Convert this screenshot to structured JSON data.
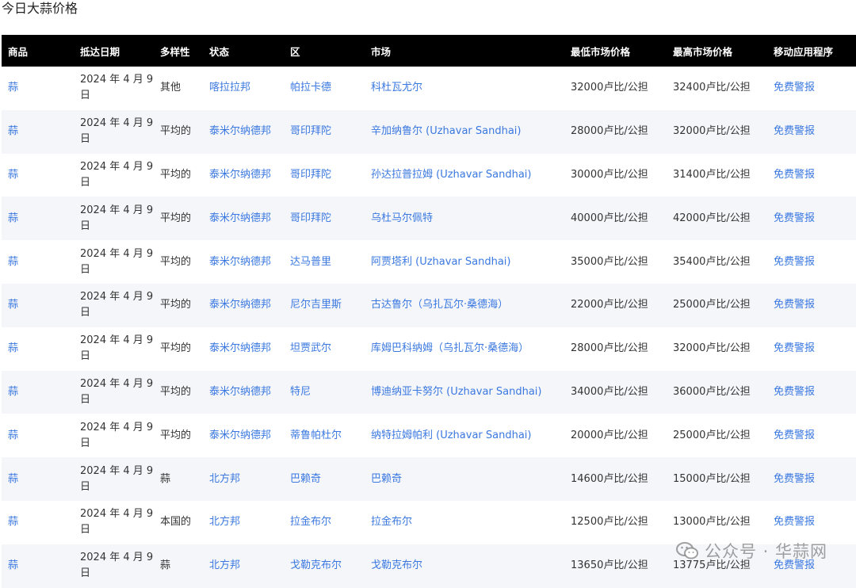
{
  "title": "今日大蒜价格",
  "columns": [
    "商品",
    "抵达日期",
    "多样性",
    "状态",
    "区",
    "市场",
    "最低市场价格",
    "最高市场价格",
    "移动应用程序"
  ],
  "rows": [
    {
      "commodity": "蒜",
      "date": "2024 年 4 月 9 日",
      "variety": "其他",
      "state": "喀拉拉邦",
      "district": "帕拉卡德",
      "market": "科杜瓦尤尔",
      "min": "32000卢比/公担",
      "max": "32400卢比/公担",
      "app": "免费警报"
    },
    {
      "commodity": "蒜",
      "date": "2024 年 4 月 9 日",
      "variety": "平均的",
      "state": "泰米尔纳德邦",
      "district": "哥印拜陀",
      "market": "辛加纳鲁尔 (Uzhavar Sandhai)",
      "min": "28000卢比/公担",
      "max": "32000卢比/公担",
      "app": "免费警报"
    },
    {
      "commodity": "蒜",
      "date": "2024 年 4 月 9 日",
      "variety": "平均的",
      "state": "泰米尔纳德邦",
      "district": "哥印拜陀",
      "market": "孙达拉普拉姆 (Uzhavar Sandhai)",
      "min": "30000卢比/公担",
      "max": "31400卢比/公担",
      "app": "免费警报"
    },
    {
      "commodity": "蒜",
      "date": "2024 年 4 月 9 日",
      "variety": "平均的",
      "state": "泰米尔纳德邦",
      "district": "哥印拜陀",
      "market": "乌杜马尔佩特",
      "min": "40000卢比/公担",
      "max": "42000卢比/公担",
      "app": "免费警报"
    },
    {
      "commodity": "蒜",
      "date": "2024 年 4 月 9 日",
      "variety": "平均的",
      "state": "泰米尔纳德邦",
      "district": "达马普里",
      "market": "阿贾塔利 (Uzhavar Sandhai)",
      "min": "35000卢比/公担",
      "max": "35400卢比/公担",
      "app": "免费警报"
    },
    {
      "commodity": "蒜",
      "date": "2024 年 4 月 9 日",
      "variety": "平均的",
      "state": "泰米尔纳德邦",
      "district": "尼尔吉里斯",
      "market": "古达鲁尔（乌扎瓦尔·桑德海）",
      "min": "22000卢比/公担",
      "max": "25000卢比/公担",
      "app": "免费警报"
    },
    {
      "commodity": "蒜",
      "date": "2024 年 4 月 9 日",
      "variety": "平均的",
      "state": "泰米尔纳德邦",
      "district": "坦贾武尔",
      "market": "库姆巴科纳姆（乌扎瓦尔·桑德海）",
      "min": "28000卢比/公担",
      "max": "32000卢比/公担",
      "app": "免费警报"
    },
    {
      "commodity": "蒜",
      "date": "2024 年 4 月 9 日",
      "variety": "平均的",
      "state": "泰米尔纳德邦",
      "district": "特尼",
      "market": "博迪纳亚卡努尔 (Uzhavar Sandhai)",
      "min": "34000卢比/公担",
      "max": "36000卢比/公担",
      "app": "免费警报"
    },
    {
      "commodity": "蒜",
      "date": "2024 年 4 月 9 日",
      "variety": "平均的",
      "state": "泰米尔纳德邦",
      "district": "蒂鲁帕杜尔",
      "market": "纳特拉姆帕利 (Uzhavar Sandhai)",
      "min": "20000卢比/公担",
      "max": "25000卢比/公担",
      "app": "免费警报"
    },
    {
      "commodity": "蒜",
      "date": "2024 年 4 月 9 日",
      "variety": "蒜",
      "state": "北方邦",
      "district": "巴赖奇",
      "market": "巴赖奇",
      "min": "14600卢比/公担",
      "max": "15000卢比/公担",
      "app": "免费警报"
    },
    {
      "commodity": "蒜",
      "date": "2024 年 4 月 9 日",
      "variety": "本国的",
      "state": "北方邦",
      "district": "拉金布尔",
      "market": "拉金布尔",
      "min": "12500卢比/公担",
      "max": "13000卢比/公担",
      "app": "免费警报"
    },
    {
      "commodity": "蒜",
      "date": "2024 年 4 月 9 日",
      "variety": "蒜",
      "state": "北方邦",
      "district": "戈勒克布尔",
      "market": "戈勒克布尔",
      "min": "13650卢比/公担",
      "max": "13775卢比/公担",
      "app": "免费警报"
    }
  ],
  "watermark": {
    "text": "公众号 · 华蒜网",
    "icon": "wechat-icon"
  }
}
